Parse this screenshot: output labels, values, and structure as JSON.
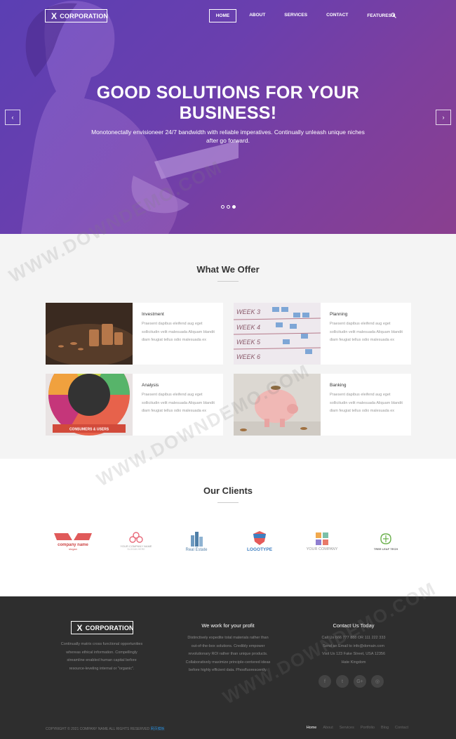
{
  "brand": {
    "logo_mark": "X",
    "name": "CORPORATION"
  },
  "nav": {
    "items": [
      "HOME",
      "ABOUT",
      "SERVICES",
      "CONTACT",
      "FEATURES"
    ],
    "active": "HOME",
    "features_caret": "▾"
  },
  "hero": {
    "title_line1": "GOOD SOLUTIONS FOR YOUR",
    "title_line2": "BUSINESS!",
    "subtitle": "Monotonectally envisioneer 24/7 bandwidth with reliable imperatives. Continually unleash unique niches after go forward.",
    "prev": "‹",
    "next": "›",
    "slides": 3,
    "active_slide": 3
  },
  "offer": {
    "title": "What We Offer",
    "items": [
      {
        "title": "Investment",
        "text": "Praesent dapibus eleifend aug eget sollicitudin velit malesuada Aliquam blandit diam feugiat tellus odio malesuada ex"
      },
      {
        "title": "Planning",
        "text": "Praesent dapibus eleifend aug eget sollicitudin velit malesuada Aliquam blandit diam feugiat tellus odio malesuada ex"
      },
      {
        "title": "Analysis",
        "text": "Praesent dapibus eleifend aug eget sollicitudin velit malesuada Aliquam blandit diam feugiat tellus odio malesuada ex"
      },
      {
        "title": "Banking",
        "text": "Praesent dapibus eleifend aug eget sollicitudin velit malesuada Aliquam blandit diam feugiat tellus odio malesuada ex"
      }
    ],
    "card_labels": {
      "planning_board": "WEEK 3",
      "analysis_wheel": "CONSUMERS & USERS"
    }
  },
  "clients": {
    "title": "Our Clients",
    "logos": [
      {
        "name": "company name",
        "sub": "slogan"
      },
      {
        "name": "YOUR COMPANY NAME",
        "sub": "SLOGAN HERE"
      },
      {
        "name": "Real Estate",
        "sub": ""
      },
      {
        "name": "LOGOTYPE",
        "sub": ""
      },
      {
        "name": "YOUR COMPANY",
        "sub": ""
      },
      {
        "name": "TREE LEAF TECH",
        "sub": ""
      }
    ]
  },
  "footer": {
    "about": "Continually matrix cross functional opportunities whereas ethical information. Compellingly streamline enabled human capital before resource-leveling internal or \"organic\".",
    "col2_title": "We work for your profit",
    "col2_text": "Distinctively expedite total materials rather than out-of-the-box solutions. Credibly empower revolutionary ROI rather than unique products. Collaboratively maximize principle-centered ideas before highly efficient data. Phosfluorescently.",
    "col3_title": "Contact Us Today",
    "contacts": [
      "Call Us 666 777 888 OR 111 222 333",
      "Send an Email to info@domain.com",
      "Visit Us 123 Fake Street, USA 12356",
      "Hate Kingdom"
    ],
    "socials": [
      "f",
      "t",
      "G+",
      "◎"
    ],
    "copyright": "COPYRIGHT © 2021 COMPANY NAME ALL RIGHTS RESERVED ",
    "copyright_brand": "网页模板",
    "bottom_nav": [
      "Home",
      "About",
      "Services",
      "Portfolio",
      "Blog",
      "Contact"
    ]
  },
  "watermark": "WWW.DOWNDEMO.COM"
}
